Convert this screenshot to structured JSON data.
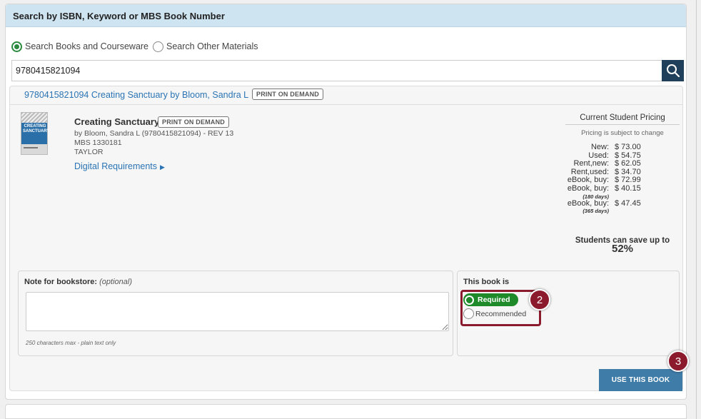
{
  "panel": {
    "title": "Search by ISBN, Keyword or MBS Book Number"
  },
  "search_modes": {
    "books": "Search Books and Courseware",
    "other": "Search Other Materials",
    "selected": "books"
  },
  "search": {
    "value": "9780415821094",
    "button_icon": "search-icon"
  },
  "result": {
    "link_text": "9780415821094  Creating Sanctuary by Bloom, Sandra L",
    "badge": "PRINT ON DEMAND",
    "cover_text": "CREATING SANCTUARY"
  },
  "book": {
    "title": "Creating Sanctuary",
    "badge": "PRINT ON DEMAND",
    "author_line": "by Bloom, Sandra L (9780415821094) - REV 13",
    "mbs": "MBS 1330181",
    "publisher": "TAYLOR",
    "digital_link": "Digital Requirements"
  },
  "pricing": {
    "title": "Current Student Pricing",
    "note": "Pricing is subject to change",
    "rows": [
      {
        "label": "New:",
        "value": "$ 73.00",
        "sub": ""
      },
      {
        "label": "Used:",
        "value": "$ 54.75",
        "sub": ""
      },
      {
        "label": "Rent,new:",
        "value": "$ 62.05",
        "sub": ""
      },
      {
        "label": "Rent,used:",
        "value": "$ 34.70",
        "sub": ""
      },
      {
        "label": "eBook, buy:",
        "value": "$ 72.99",
        "sub": ""
      },
      {
        "label": "eBook, buy:",
        "value": "$ 40.15",
        "sub": "(180 days)"
      },
      {
        "label": "eBook, buy:",
        "value": "$ 47.45",
        "sub": "(365 days)"
      }
    ],
    "save_text": "Students can save up to",
    "save_pct": "52%"
  },
  "note": {
    "label": "Note for bookstore:",
    "optional": "(optional)",
    "value": "",
    "hint": "250 characters max - plain text only"
  },
  "requirement": {
    "label": "This book is",
    "required": "Required",
    "recommended": "Recommended",
    "selected": "required"
  },
  "actions": {
    "use_book": "USE THIS BOOK"
  },
  "callouts": {
    "step2": "2",
    "step3": "3"
  },
  "colors": {
    "header_bg": "#cfe4f1",
    "link": "#2a74b4",
    "required_green": "#1f8a2a",
    "callout": "#8b1b2c",
    "button": "#3f7ca8",
    "search_button": "#1f3f5a"
  }
}
